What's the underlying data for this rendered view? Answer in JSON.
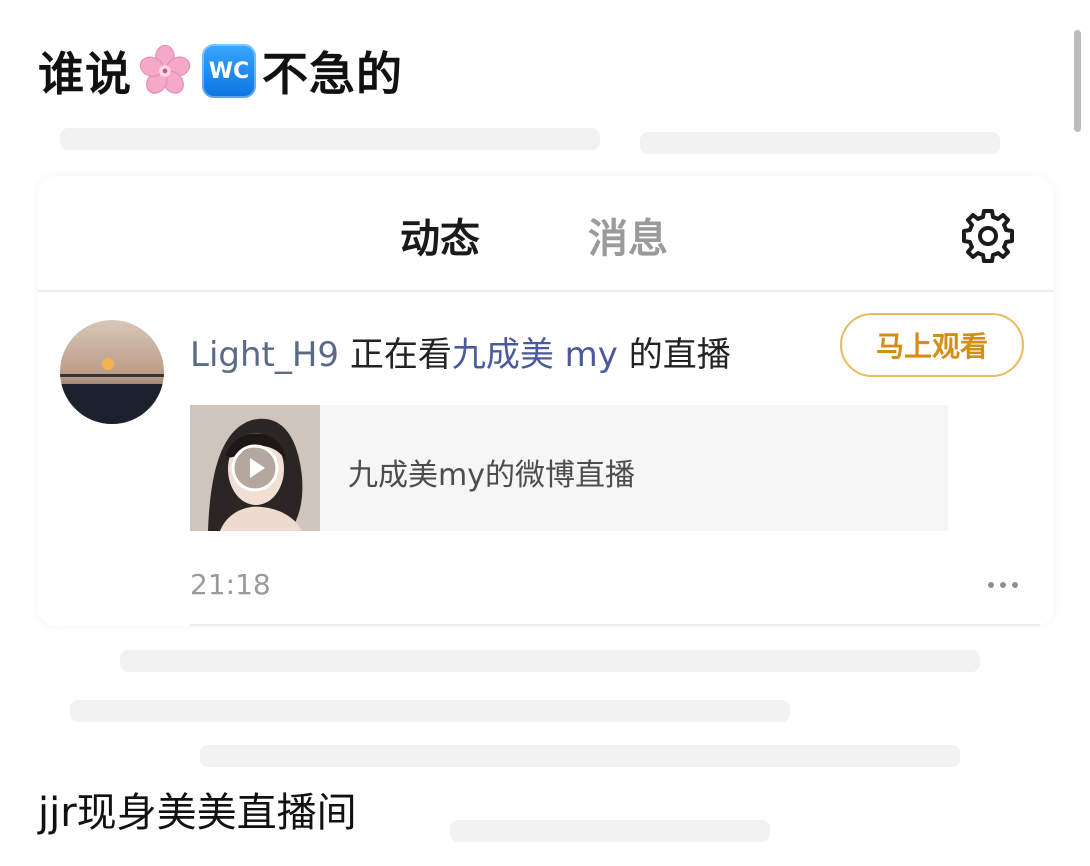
{
  "post": {
    "headline_prefix": "谁说",
    "headline_flower_icon": "cherry-blossom-icon",
    "headline_wc_badge": "WC",
    "headline_suffix": "不急的",
    "caption": "jjr现身美美直播间"
  },
  "panel": {
    "tabs": [
      {
        "label": "动态",
        "active": true
      },
      {
        "label": "消息",
        "active": false
      }
    ],
    "settings_icon": "gear-icon"
  },
  "feed": {
    "user_name": "Light_H9",
    "watching_text": "正在看",
    "host_name": "九成美 my",
    "stream_suffix": "的直播",
    "watch_button": "马上观看",
    "live_card_title": "九成美my的微博直播",
    "play_icon": "play-icon",
    "timestamp": "21:18",
    "more_icon": "more-icon"
  },
  "colors": {
    "accent_yellow": "#ffc02e",
    "button_border": "#e8bb62",
    "button_text": "#d38f14",
    "link_user": "#5b6b86",
    "link_host": "#4a5a9a",
    "muted_text": "#9a9a9a"
  }
}
